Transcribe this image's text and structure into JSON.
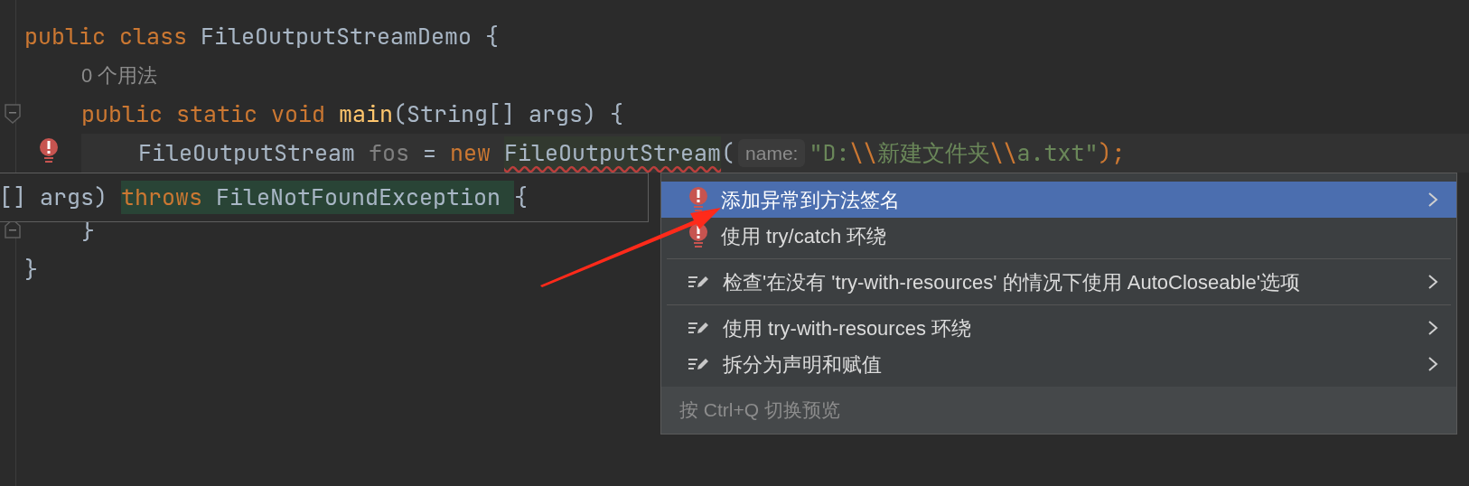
{
  "editor": {
    "lines": [
      {
        "kind": "plain",
        "tokens": [
          {
            "text": "public class",
            "kind": "keyword"
          },
          {
            "text": " FileOutputStreamDemo {",
            "kind": "plain"
          }
        ],
        "children": [
          {
            "kind": "plain",
            "tokens": [
              {
                "text": "0 个用法",
                "kind": "usage"
              }
            ]
          },
          {
            "kind": "fold_start",
            "tokens": [
              {
                "text": "public static void ",
                "kind": "keyword"
              },
              {
                "text": "main",
                "kind": "method"
              },
              {
                "text": "(String[] args) {",
                "kind": "plain"
              }
            ],
            "children": [
              {
                "kind": "error",
                "tokens": [
                  {
                    "text": "FileOutputStream ",
                    "kind": "plain"
                  },
                  {
                    "text": "fos",
                    "kind": "unused"
                  },
                  {
                    "text": " = ",
                    "kind": "plain"
                  },
                  {
                    "text": "new ",
                    "kind": "keyword"
                  },
                  {
                    "text": "FileOutputStream",
                    "kind": "error"
                  },
                  {
                    "text": "(",
                    "kind": "plain"
                  },
                  {
                    "text": "name:",
                    "kind": "hint"
                  },
                  {
                    "text": "\"D:",
                    "kind": "string"
                  },
                  {
                    "text": "\\\\",
                    "kind": "escape"
                  },
                  {
                    "text": "新建文件夹",
                    "kind": "string"
                  },
                  {
                    "text": "\\\\",
                    "kind": "escape"
                  },
                  {
                    "text": "a.txt\"",
                    "kind": "string"
                  },
                  {
                    "text": ");",
                    "kind": "keyword"
                  }
                ]
              }
            ]
          },
          {
            "kind": "fold_end",
            "tokens": [
              {
                "text": "}",
                "kind": "plain"
              }
            ]
          }
        ]
      },
      {
        "kind": "plain",
        "tokens": [
          {
            "text": "}",
            "kind": "plain"
          }
        ]
      }
    ]
  },
  "preview": {
    "tokens": [
      {
        "text": "[] args) ",
        "kind": "plain"
      },
      {
        "text": "throws",
        "kind": "added_keyword"
      },
      {
        "text": " FileNotFoundException ",
        "kind": "added"
      },
      {
        "text": "{",
        "kind": "plain"
      }
    ]
  },
  "menu": {
    "items": [
      {
        "label": "添加异常到方法签名",
        "kind": "error",
        "submenu": true,
        "selected": true,
        "separator_before": false
      },
      {
        "label": "使用 try/catch 环绕",
        "kind": "error",
        "submenu": false,
        "selected": false,
        "separator_before": false
      },
      {
        "label": "检查'在没有 'try-with-resources' 的情况下使用 AutoCloseable'选项",
        "kind": "edit",
        "submenu": true,
        "selected": false,
        "separator_before": true
      },
      {
        "label": "使用 try-with-resources 环绕",
        "kind": "edit",
        "submenu": true,
        "selected": false,
        "separator_before": true
      },
      {
        "label": "拆分为声明和赋值",
        "kind": "edit",
        "submenu": true,
        "selected": false,
        "separator_before": false
      }
    ],
    "footer": "按 Ctrl+Q 切换预览"
  }
}
